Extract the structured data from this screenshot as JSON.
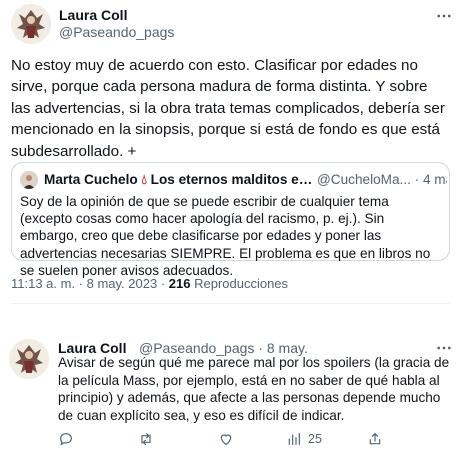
{
  "main_tweet": {
    "author_name": "Laura Coll",
    "author_handle": "@Paseando_pags",
    "more_icon": "more-horizontal-icon",
    "text": "No estoy muy de acuerdo con esto. Clasificar por edades no sirve, porque cada persona madura de forma distinta. Y sobre las advertencias, si la obra trata temas complicados, debería ser mencionado en la sinopsis, porque si está de fondo es que está subdesarrollado. +",
    "quoted": {
      "author_name": "Marta Cuchelo",
      "name_icon": "drop-of-blood-icon",
      "name_rest": "Los eternos malditos en físic...",
      "handle_date": "@CucheloMa... · 4 mar.",
      "text": "Soy de la opinión de que se puede escribir de cualquier tema (excepto cosas como hacer apología del racismo, p. ej.). Sin embargo, creo que debe clasificarse por edades y poner las advertencias necesarias SIEMPRE. El problema es que en libros no se suelen poner avisos adecuados."
    },
    "time": "11:13 a. m. · 8 may. 2023 · ",
    "views_count": "216",
    "views_label": " Reproducciones"
  },
  "reply": {
    "author_name": "Laura Coll",
    "author_handle": "@Paseando_pags · 8 may.",
    "text": "Avisar de según qué me parece mal por los spoilers (la gracia de la película Mass, por ejemplo, está en no saber de qué habla al principio) y además, que afecte a las personas depende mucho de cuan explícito sea, y eso es difícil de indicar.",
    "actions": {
      "reply_icon": "reply-icon",
      "retweet_icon": "retweet-icon",
      "like_icon": "heart-icon",
      "views_icon": "views-chart-icon",
      "views_count": "25",
      "share_icon": "share-icon"
    }
  },
  "colors": {
    "text": "#0f1419",
    "secondary": "#536471",
    "border": "#cfd9de",
    "drop": "#d62828"
  }
}
